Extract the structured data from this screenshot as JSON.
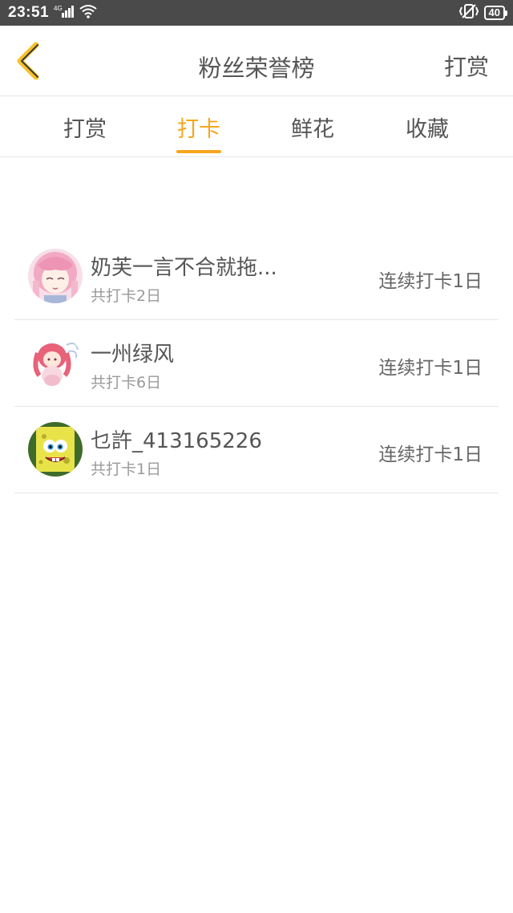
{
  "status_bar": {
    "time": "23:51",
    "network": "4G",
    "battery": "40"
  },
  "header": {
    "title": "粉丝荣誉榜",
    "action": "打赏"
  },
  "tabs": [
    {
      "label": "打赏",
      "active": false
    },
    {
      "label": "打卡",
      "active": true
    },
    {
      "label": "鲜花",
      "active": false
    },
    {
      "label": "收藏",
      "active": false
    }
  ],
  "colors": {
    "accent": "#f7a61c",
    "text": "#555555",
    "subtext": "#9a9a9a",
    "status_bar": "#4a4a4a"
  },
  "fans": [
    {
      "name": "奶芙一言不合就拖...",
      "total": "共打卡2日",
      "streak": "连续打卡1日",
      "avatar": "anime-girl-pink-avatar"
    },
    {
      "name": "一州绿风",
      "total": "共打卡6日",
      "streak": "连续打卡1日",
      "avatar": "anime-girl-red-hair-avatar"
    },
    {
      "name": "乜許_413165226",
      "total": "共打卡1日",
      "streak": "连续打卡1日",
      "avatar": "spongebob-avatar"
    }
  ]
}
